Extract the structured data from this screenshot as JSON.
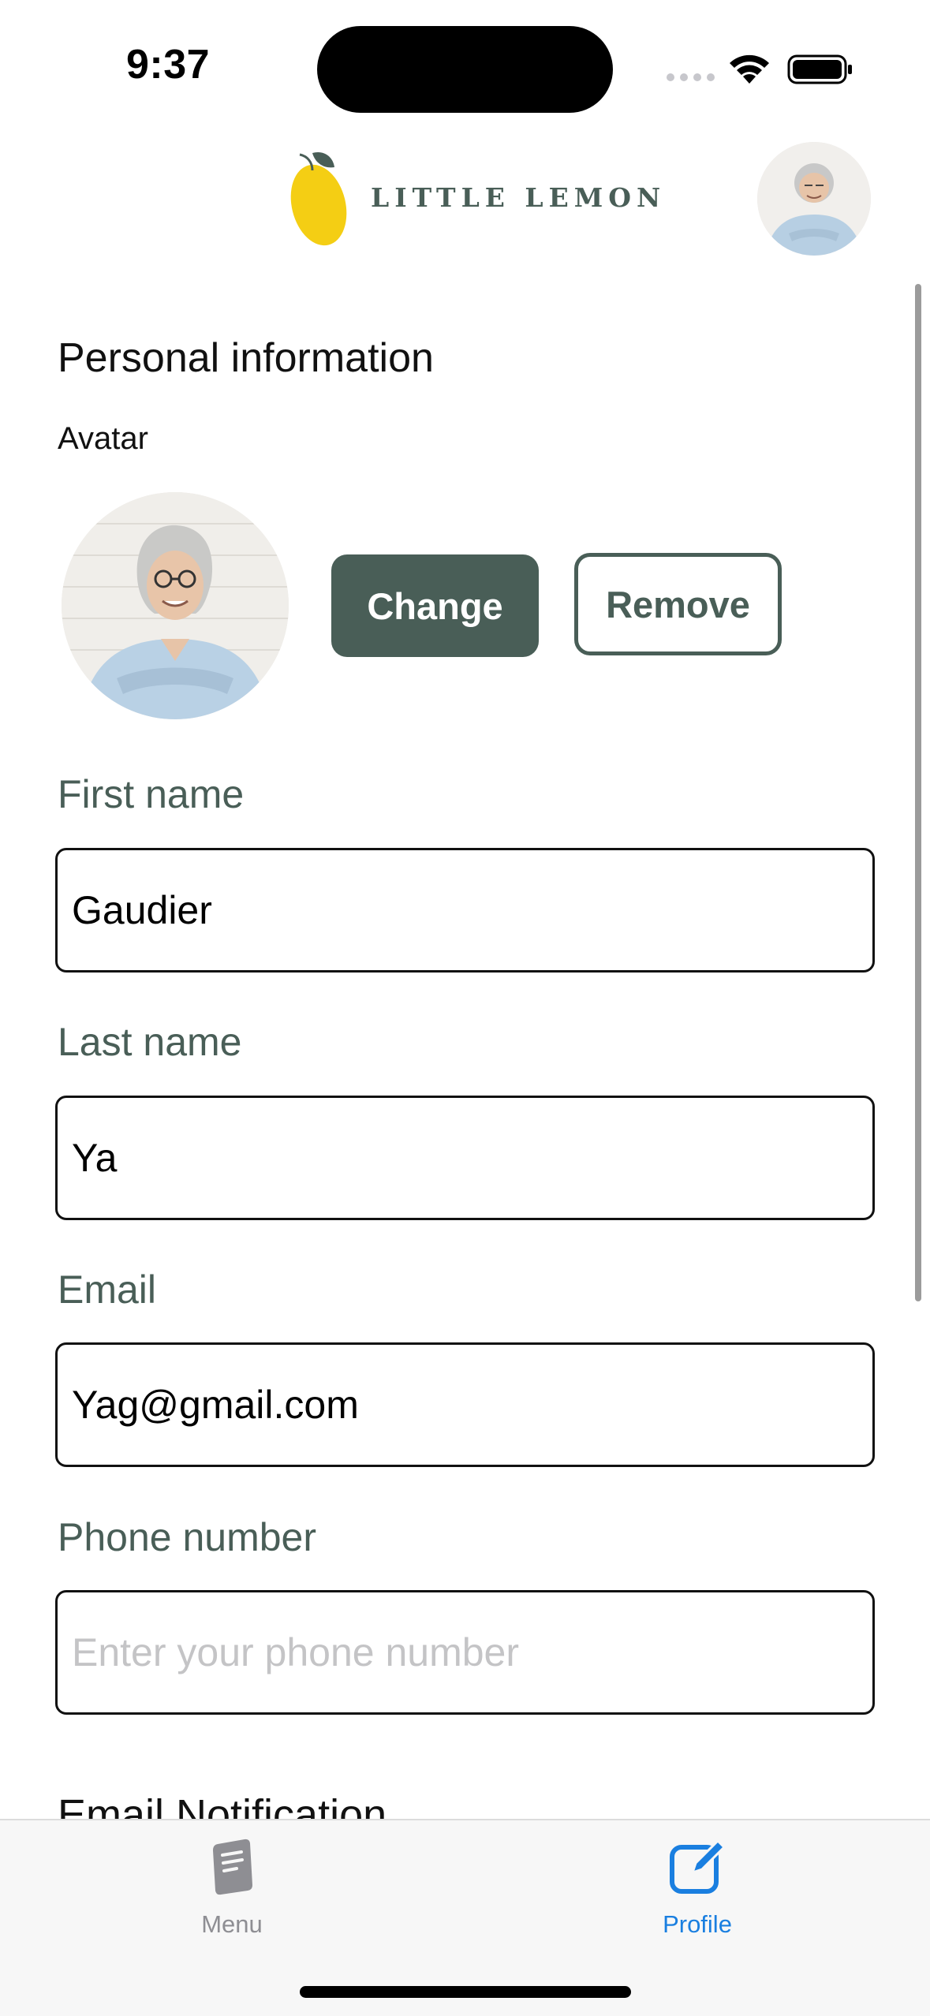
{
  "status_bar": {
    "time": "9:37"
  },
  "header": {
    "logo_text": "LITTLE LEMON",
    "logo_icon": "lemon-icon",
    "profile_avatar_icon": "person-avatar"
  },
  "personal_info": {
    "title": "Personal information",
    "avatar_label": "Avatar",
    "change_button": "Change",
    "remove_button": "Remove"
  },
  "form": {
    "first_name": {
      "label": "First name",
      "value": "Gaudier"
    },
    "last_name": {
      "label": "Last name",
      "value": "Ya"
    },
    "email": {
      "label": "Email",
      "value": "Yag@gmail.com"
    },
    "phone": {
      "label": "Phone number",
      "value": "",
      "placeholder": "Enter your phone number"
    }
  },
  "next_section_heading": "Email Notification",
  "tab_bar": {
    "items": [
      {
        "label": "Menu",
        "icon": "document-icon",
        "active": false
      },
      {
        "label": "Profile",
        "icon": "edit-square-icon",
        "active": true
      }
    ]
  },
  "colors": {
    "primary_green": "#495e57",
    "lemon_yellow": "#f4ce14",
    "active_tab_blue": "#1a7fe0",
    "inactive_tab_gray": "#8e8e93"
  }
}
